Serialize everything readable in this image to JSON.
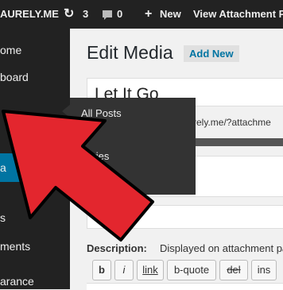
{
  "admin_bar": {
    "site_name": "AURELY.ME",
    "updates_count": "3",
    "comments_count": "0",
    "new_label": "New",
    "view_label": "View Attachment P"
  },
  "sidebar": {
    "items": [
      {
        "label": "ome"
      },
      {
        "label": "board"
      },
      {
        "label": "a"
      },
      {
        "label": "s"
      },
      {
        "label": "ments"
      },
      {
        "label": "arance"
      }
    ]
  },
  "flyout": {
    "items": [
      "All Posts",
      "gories"
    ]
  },
  "content": {
    "page_title": "Edit Media",
    "add_new_label": "Add New",
    "post_title_value": "Let It Go",
    "permalink_text": "rely.me/?attachme",
    "description_label": "Description:",
    "description_hint": "Displayed on attachment pa",
    "quicktags": [
      "b",
      "i",
      "link",
      "b-quote",
      "del",
      "ins"
    ]
  },
  "colors": {
    "admin_bar_bg": "#222222",
    "active_menu": "#0074a2",
    "arrow_red": "#e3262e",
    "add_new_bg": "#e0e0e0"
  }
}
